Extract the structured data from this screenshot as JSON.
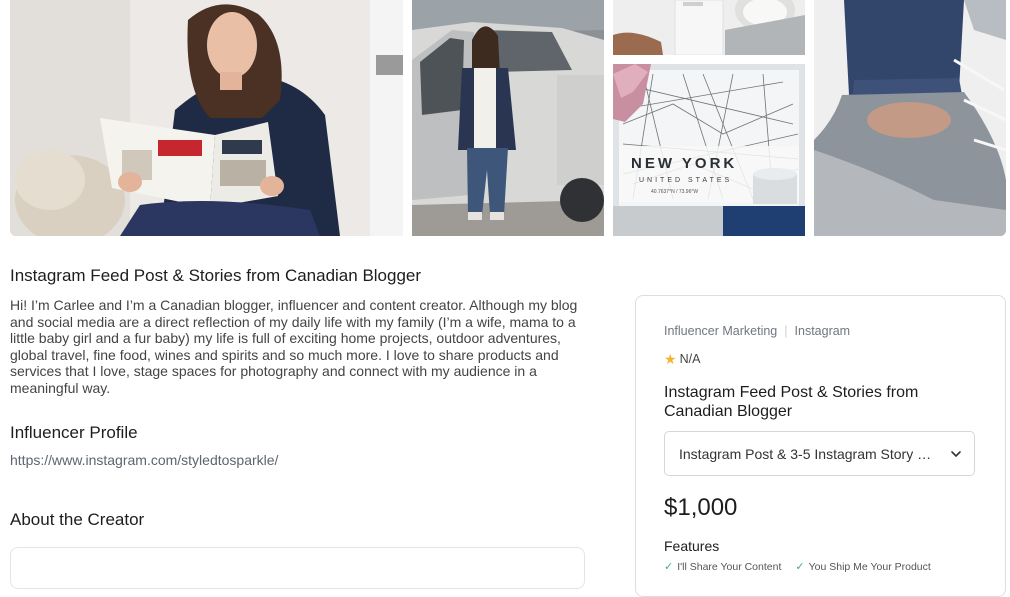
{
  "gallery": {
    "photo4_text": {
      "city": "NEW YORK",
      "country": "UNITED STATES",
      "coords": "40.7637°N / 73.96°W"
    }
  },
  "listing": {
    "title": "Instagram Feed Post & Stories from Canadian Blogger",
    "description": "Hi! I’m Carlee and I’m a Canadian blogger, influencer and content creator. Although my blog and social media are a direct reflection of my daily life with my family (I’m a wife, mama to a little baby girl and a fur baby) my life is full of exciting home projects, outdoor adventures, global travel, fine food, wines and spirits and so much more. I love to share products and services that I love, stage spaces for photography and connect with my audience in a meaningful way.",
    "profile_heading": "Influencer Profile",
    "profile_url": "https://www.instagram.com/styledtosparkle/",
    "about_heading": "About the Creator"
  },
  "card": {
    "categories": [
      "Influencer Marketing",
      "Instagram"
    ],
    "rating": "N/A",
    "title": "Instagram Feed Post & Stories from Canadian Blogger",
    "package_select": "Instagram Post & 3-5 Instagram Story S...",
    "price": "$1,000",
    "features_heading": "Features",
    "features": [
      "I'll Share Your Content",
      "You Ship Me Your Product"
    ]
  },
  "icons": {
    "rating": "star-icon",
    "select": "chevron-down-icon",
    "feature": "check-icon"
  },
  "colors": {
    "star": "#f3b432",
    "check": "#3bb07a",
    "link": "#5b6570"
  }
}
